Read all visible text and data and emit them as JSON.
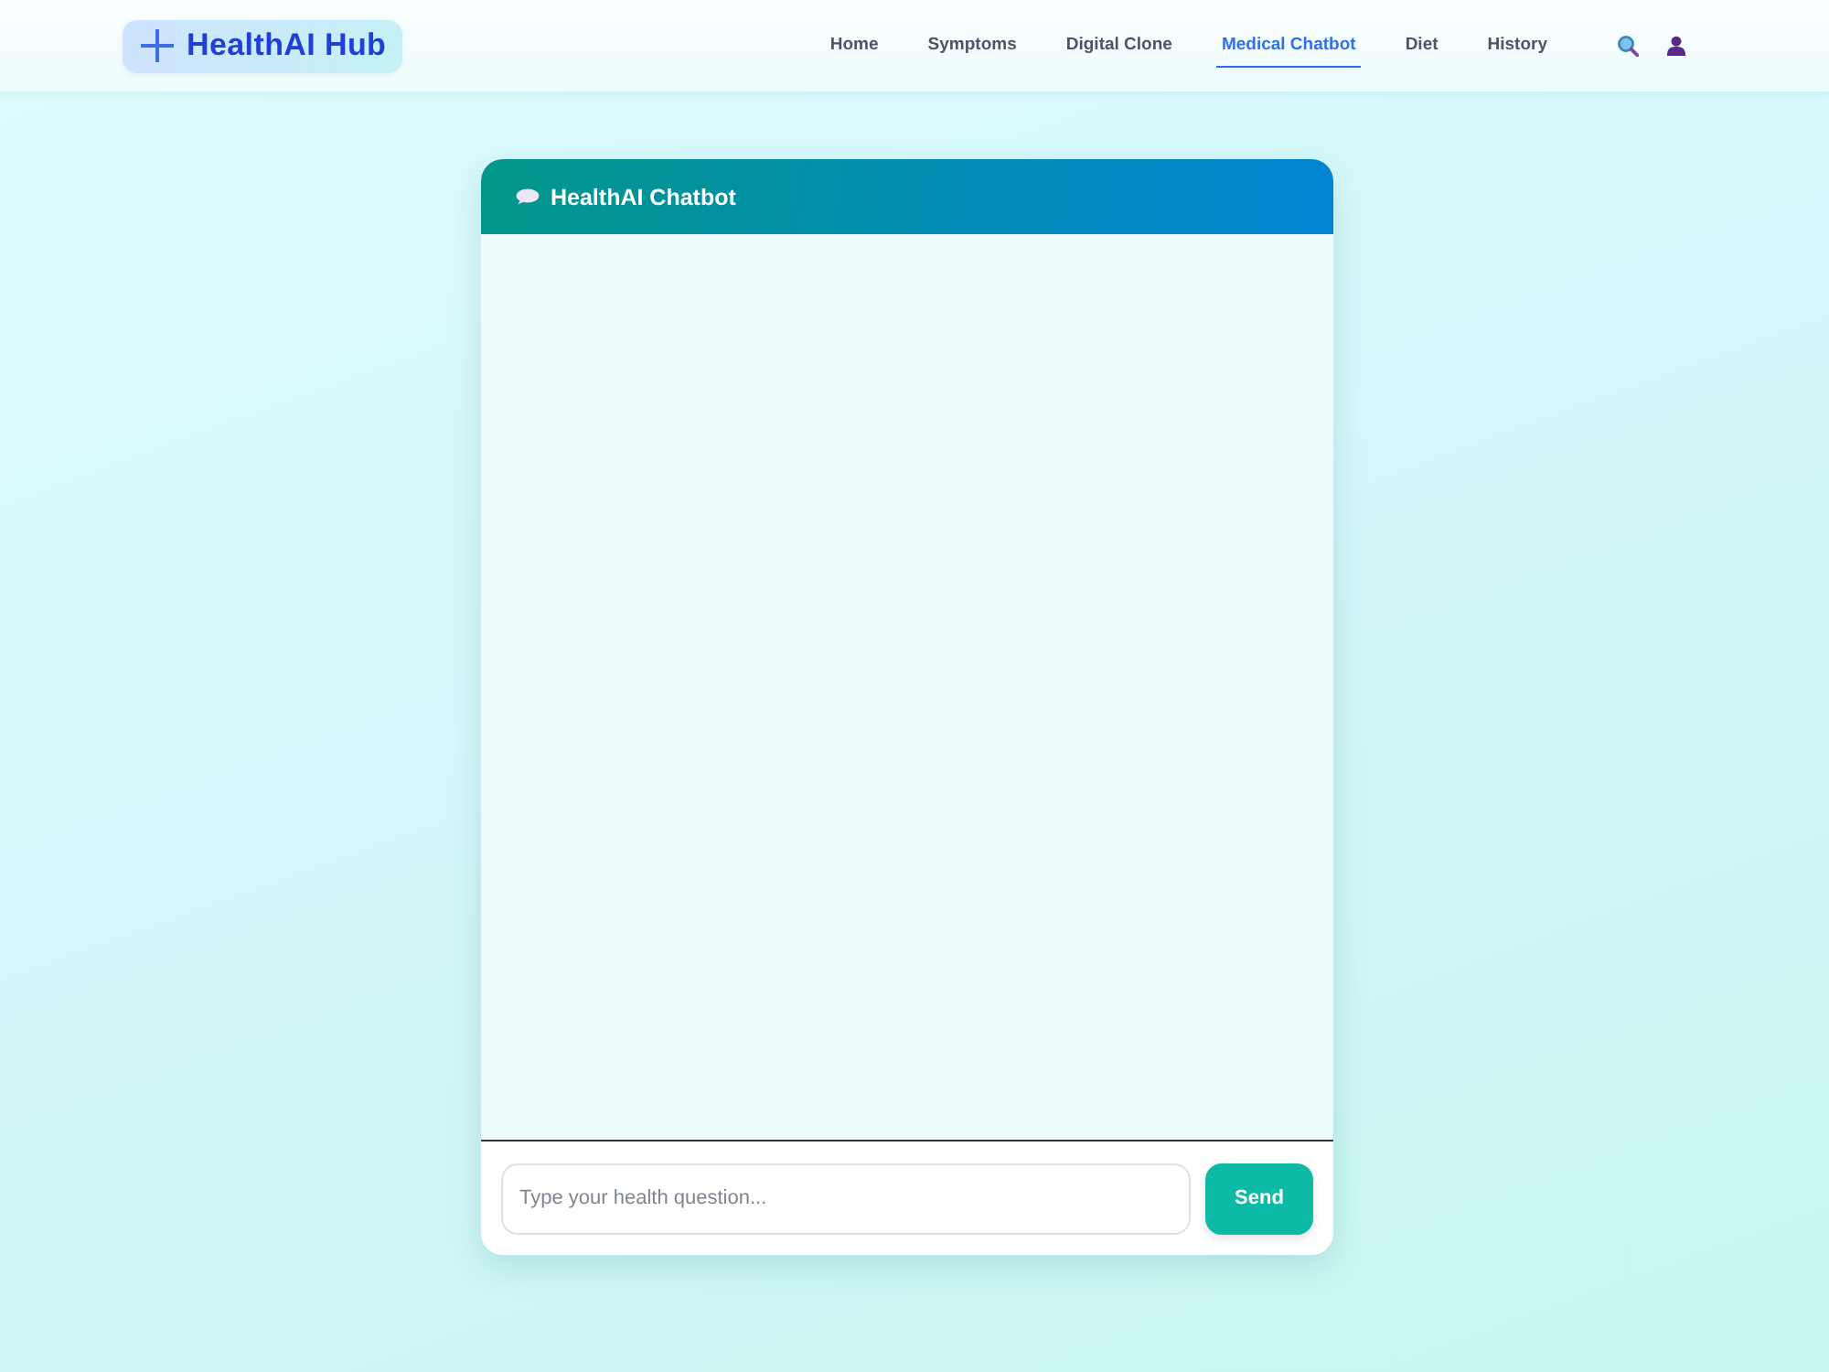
{
  "navbar": {
    "logo": {
      "text": "HealthAI Hub"
    },
    "links": [
      {
        "label": "Home",
        "selected": false
      },
      {
        "label": "Symptoms",
        "selected": false
      },
      {
        "label": "Digital Clone",
        "selected": false
      },
      {
        "label": "Medical Chatbot",
        "selected": true
      },
      {
        "label": "Diet",
        "selected": false
      },
      {
        "label": "History",
        "selected": false
      }
    ]
  },
  "chat": {
    "title": "HealthAI Chatbot",
    "input": {
      "placeholder": "Type your health question..."
    },
    "send_button": "Send"
  }
}
